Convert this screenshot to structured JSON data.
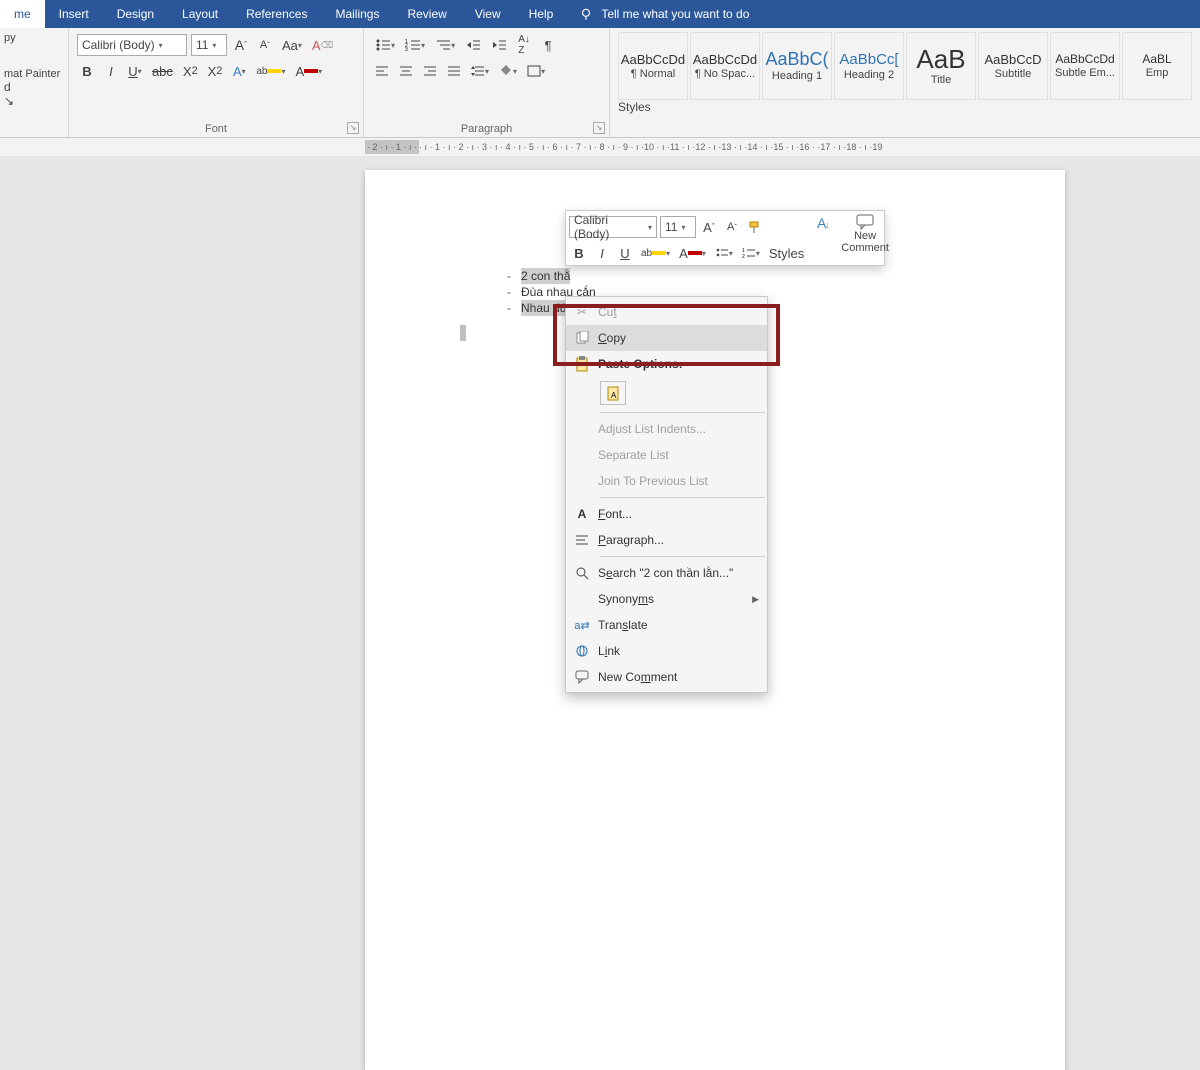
{
  "tabs": [
    "me",
    "Insert",
    "Design",
    "Layout",
    "References",
    "Mailings",
    "Review",
    "View",
    "Help"
  ],
  "active_tab_index": 0,
  "tell_me": "Tell me what you want to do",
  "clipboard": {
    "l1": "py",
    "l2": "mat Painter",
    "title": "d"
  },
  "font": {
    "name": "Calibri (Body)",
    "size": "11",
    "title": "Font"
  },
  "paragraph": {
    "title": "Paragraph"
  },
  "styles": {
    "title": "Styles",
    "items": [
      {
        "preview": "AaBbCcDd",
        "label": "¶ Normal",
        "blue": false,
        "size": 13
      },
      {
        "preview": "AaBbCcDd",
        "label": "¶ No Spac...",
        "blue": false,
        "size": 13
      },
      {
        "preview": "AaBbC(",
        "label": "Heading 1",
        "blue": true,
        "size": 18
      },
      {
        "preview": "AaBbCc[",
        "label": "Heading 2",
        "blue": true,
        "size": 15
      },
      {
        "preview": "AaB",
        "label": "Title",
        "blue": false,
        "size": 26
      },
      {
        "preview": "AaBbCcD",
        "label": "Subtitle",
        "blue": false,
        "size": 13
      },
      {
        "preview": "AaBbCcDd",
        "label": "Subtle Em...",
        "blue": false,
        "size": 12
      },
      {
        "preview": "AaBL",
        "label": "Emp",
        "blue": false,
        "size": 12
      }
    ]
  },
  "ruler_left": "· 2 · ı · 1 · ı ·",
  "ruler_right": " · ı · 1 · ı · 2 · ı · 3 · ı · 4 · ı · 5 · ı · 6 · ı · 7 · ı · 8 · ı · 9 · ı ·10 · ı ·11 · ı ·12 · ı ·13 · ı ·14 · ı ·15 · ı ·16 ·  ·17 · ı ·18 · ı ·19",
  "document": {
    "lines": [
      "2 con thằ",
      "Đùa nhau cắn",
      "Nhau đứ"
    ]
  },
  "mini_toolbar": {
    "font": "Calibri (Body)",
    "size": "11",
    "styles": "Styles",
    "new_comment_l1": "New",
    "new_comment_l2": "Comment"
  },
  "context_menu": {
    "cut": "Cut",
    "copy": "Copy",
    "paste_options": "Paste Options:",
    "adjust": "Adjust List Indents...",
    "separate": "Separate List",
    "join": "Join To Previous List",
    "font": "Font...",
    "paragraph": "Paragraph...",
    "search": "Search \"2 con thần lằn...\"",
    "synonyms": "Synonyms",
    "translate": "Translate",
    "link": "Link",
    "new_comment": "New Comment"
  }
}
